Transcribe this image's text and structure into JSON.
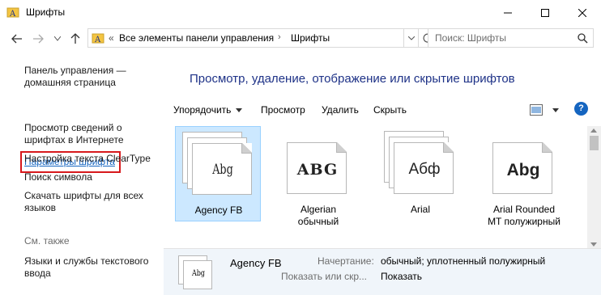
{
  "window": {
    "title": "Шрифты",
    "icon": "fonts-folder-icon"
  },
  "address": {
    "overflow": "«",
    "crumbs": [
      "Все элементы панели управления",
      "Шрифты"
    ],
    "search_placeholder": "Поиск: Шрифты"
  },
  "left_pane": {
    "links": [
      "Панель управления — домашняя страница",
      "Параметры шрифта",
      "Просмотр сведений о шрифтах в Интернете",
      "Настройка текста ClearType",
      "Поиск символа",
      "Скачать шрифты для всех языков"
    ],
    "see_also": "См. также",
    "see_also_links": [
      "Языки и службы текстового ввода"
    ]
  },
  "main": {
    "heading": "Просмотр, удаление, отображение или скрытие шрифтов",
    "commands": {
      "organize": "Упорядочить",
      "preview": "Просмотр",
      "delete": "Удалить",
      "hide": "Скрыть"
    },
    "fonts": [
      {
        "name": "Agency FB",
        "sample": "Abg",
        "selected": true
      },
      {
        "name": "Algerian обычный",
        "sample": "ABG",
        "selected": false
      },
      {
        "name": "Arial",
        "sample": "Абф",
        "selected": false
      },
      {
        "name": "Arial Rounded MT полужирный",
        "sample": "Abg",
        "selected": false
      }
    ]
  },
  "details": {
    "name": "Agency FB",
    "style_label": "Начертание:",
    "style_value": "обычный; уплотненный полужирный",
    "show_label": "Показать или скр...",
    "show_value": "Показать",
    "thumb_sample": "Abg"
  },
  "colors": {
    "heading": "#1e3287",
    "link_selected": "#1565c0",
    "highlight_border": "#d7191c",
    "selection_bg": "#cce8ff"
  }
}
